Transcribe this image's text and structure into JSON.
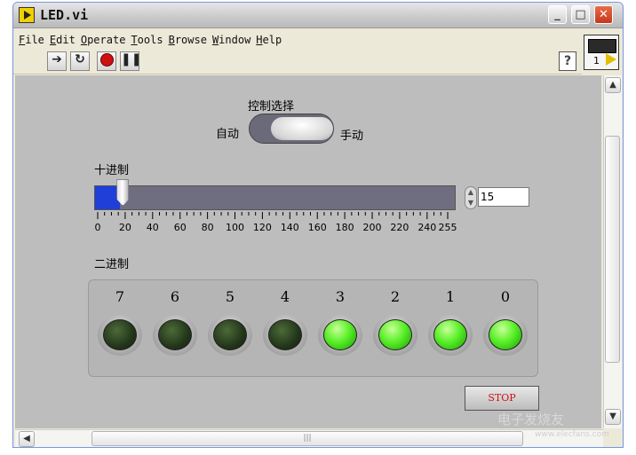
{
  "window": {
    "title": "LED.vi",
    "minimize": "_",
    "maximize": "□",
    "close": "✕"
  },
  "menu": [
    {
      "hot": "F",
      "rest": "ile"
    },
    {
      "hot": "E",
      "rest": "dit"
    },
    {
      "hot": "O",
      "rest": "perate"
    },
    {
      "hot": "T",
      "rest": "ools"
    },
    {
      "hot": "B",
      "rest": "rowse"
    },
    {
      "hot": "W",
      "rest": "indow"
    },
    {
      "hot": "H",
      "rest": "elp"
    }
  ],
  "toolbar": {
    "run_icon": "run-arrow-icon",
    "run_continuous_icon": "run-continuously-icon",
    "abort_icon": "abort-icon",
    "pause_icon": "pause-icon",
    "help_label": "?"
  },
  "vi_icon": {
    "number": "1"
  },
  "control": {
    "title": "控制选择",
    "left_label": "自动",
    "right_label": "手动"
  },
  "slider": {
    "label": "十进制",
    "value": "15",
    "min": 0,
    "max": 255,
    "ticks": [
      "0",
      "20",
      "40",
      "60",
      "80",
      "100",
      "120",
      "140",
      "160",
      "180",
      "200",
      "220",
      "240",
      "255"
    ],
    "fill_color": "#1f3fd8"
  },
  "binary": {
    "label": "二进制",
    "bits": [
      {
        "num": "7",
        "on": false
      },
      {
        "num": "6",
        "on": false
      },
      {
        "num": "5",
        "on": false
      },
      {
        "num": "4",
        "on": false
      },
      {
        "num": "3",
        "on": true
      },
      {
        "num": "2",
        "on": true
      },
      {
        "num": "1",
        "on": true
      },
      {
        "num": "0",
        "on": true
      }
    ]
  },
  "stop_button": {
    "label": "STOP",
    "color": "#d01010"
  },
  "watermark": {
    "text": "电子发烧友",
    "sub": "www.elecfans.com"
  }
}
